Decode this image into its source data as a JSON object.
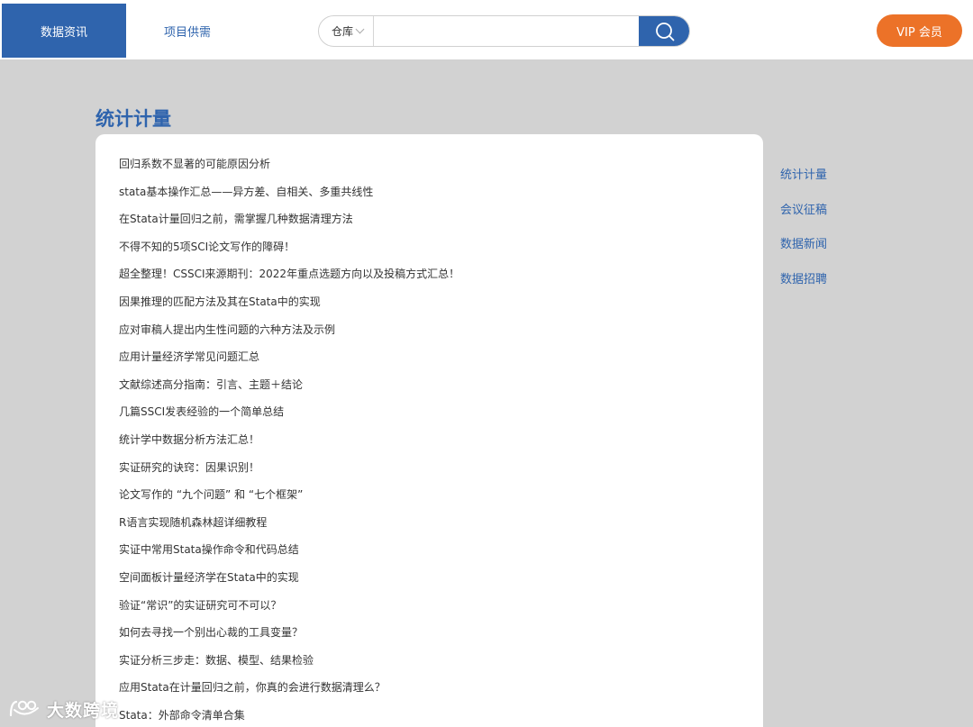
{
  "header": {
    "tabs": [
      {
        "label": "数据资讯",
        "active": true
      },
      {
        "label": "项目供需",
        "active": false
      }
    ],
    "search": {
      "category": "仓库",
      "placeholder": "",
      "icon": "search-icon"
    },
    "vip_label": "VIP 会员"
  },
  "colors": {
    "brand_blue": "#2f64ad",
    "vip_orange": "#ec7228",
    "background": "#d2d2d2"
  },
  "main": {
    "title": "统计计量",
    "articles": [
      "回归系数不显著的可能原因分析",
      "stata基本操作汇总——异方差、自相关、多重共线性",
      "在Stata计量回归之前，需掌握几种数据清理方法",
      "不得不知的5项SCI论文写作的障碍！",
      "超全整理！CSSCI来源期刊：2022年重点选题方向以及投稿方式汇总！",
      "因果推理的匹配方法及其在Stata中的实现",
      "应对审稿人提出内生性问题的六种方法及示例",
      "应用计量经济学常见问题汇总",
      "文献综述高分指南：引言、主题＋结论",
      "几篇SSCI发表经验的一个简单总结",
      "统计学中数据分析方法汇总！",
      "实证研究的诀窍：因果识别！",
      "论文写作的 “九个问题” 和 “七个框架”",
      "R语言实现随机森林超详细教程",
      "实证中常用Stata操作命令和代码总结",
      "空间面板计量经济学在Stata中的实现",
      "验证“常识”的实证研究可不可以？",
      "如何去寻找一个别出心裁的工具变量？",
      "实证分析三步走：数据、模型、结果检验",
      "应用Stata在计量回归之前，你真的会进行数据清理么？",
      "Stata：外部命令清单合集"
    ]
  },
  "sidebar": {
    "items": [
      "统计计量",
      "会议征稿",
      "数据新闻",
      "数据招聘"
    ]
  },
  "watermark": {
    "text": "大数跨境"
  }
}
